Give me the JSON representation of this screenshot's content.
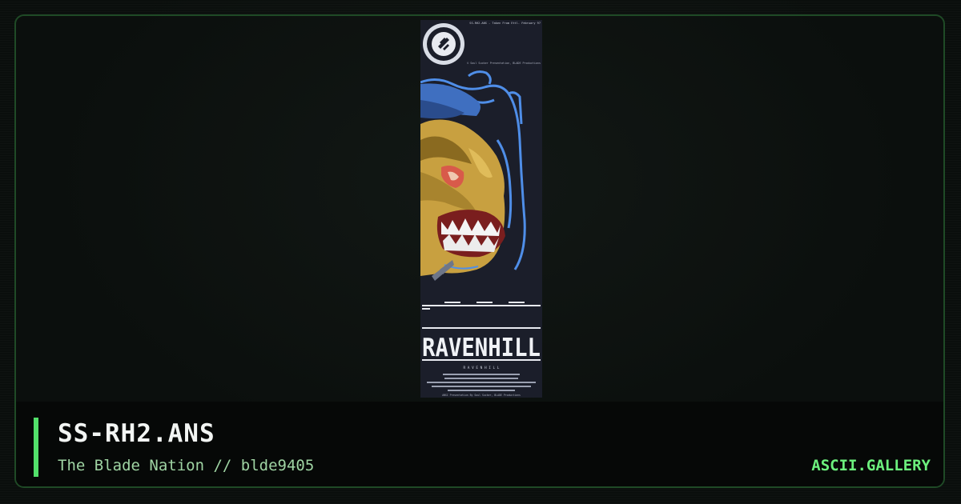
{
  "artwork": {
    "header_line": "SS-RH2.ANS - Taken From Ettl. February 97",
    "credit_line": "© Soul Sucker Presentation, BLADE Productions",
    "logo_text": "RAVENHILL",
    "sub_logo_text": "R A V E N H I L L",
    "icon": "ss-emblem-icon",
    "footer_line": "ANSI Presentation By Soul Sucker, BLADE Productions"
  },
  "caption": {
    "title": "SS-RH2.ANS",
    "subtitle": "The Blade Nation // blde9405",
    "brand": "ASCII.GALLERY"
  },
  "colors": {
    "accent": "#52e06a",
    "frame_border": "#1f4a26",
    "art_bg": "#1b1e2a",
    "skin": "#c8a040",
    "hair": "#4f8ee8"
  }
}
